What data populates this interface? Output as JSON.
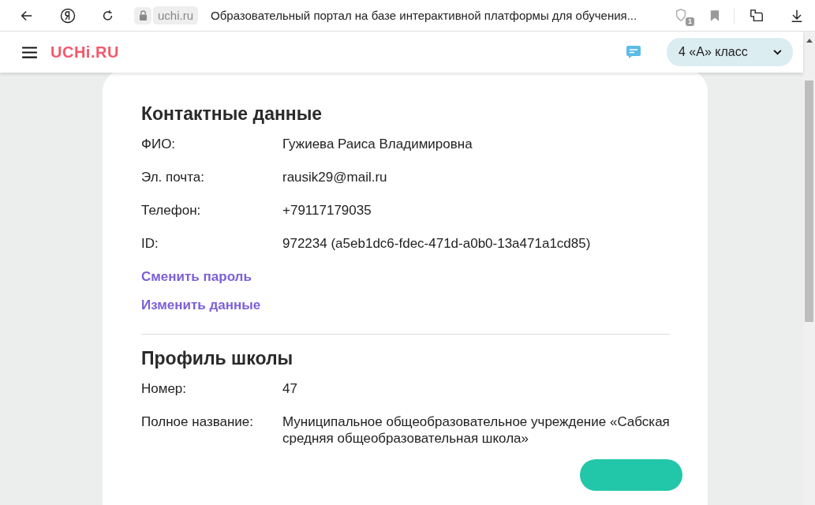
{
  "browser": {
    "address": "uchi.ru",
    "page_title": "Образовательный портал на базе интерактивной платформы для обучения...",
    "protect_badge": "1"
  },
  "header": {
    "logo": "UCHi.RU",
    "class_selector": "4 «А» класс"
  },
  "contacts": {
    "title": "Контактные данные",
    "fields": [
      {
        "label": "ФИО:",
        "value": "Гужиева Раиса Владимировна"
      },
      {
        "label": "Эл. почта:",
        "value": "rausik29@mail.ru"
      },
      {
        "label": "Телефон:",
        "value": "+79117179035"
      },
      {
        "label": "ID:",
        "value": "972234 (a5eb1dc6-fdec-471d-a0b0-13a471a1cd85)"
      }
    ],
    "links": [
      "Сменить пароль",
      "Изменить данные"
    ]
  },
  "school": {
    "title": "Профиль школы",
    "fields": [
      {
        "label": "Номер:",
        "value": "47"
      },
      {
        "label": "Полное название:",
        "value": "Муниципальное общеобразовательное учреждение «Сабская средняя общеобразовательная школа»"
      }
    ]
  }
}
